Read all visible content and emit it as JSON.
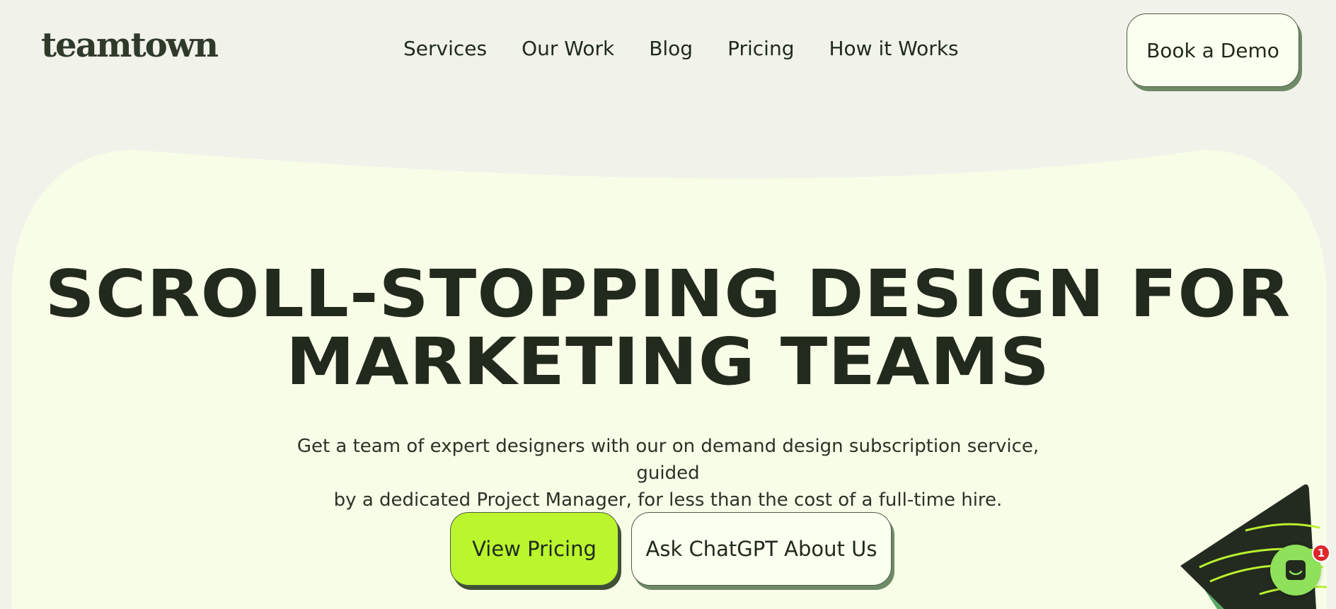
{
  "header": {
    "logo": "teamtown",
    "nav": [
      "Services",
      "Our Work",
      "Blog",
      "Pricing",
      "How it Works"
    ],
    "cta": "Book a Demo"
  },
  "hero": {
    "headline_line1": "SCROLL-STOPPING DESIGN FOR",
    "headline_line2": "MARKETING TEAMS",
    "subtitle_line1": "Get a team of expert designers with our on demand design subscription service, guided",
    "subtitle_line2": "by a dedicated Project Manager, for less than the cost of a full-time hire.",
    "primary_button": "View Pricing",
    "secondary_button": "Ask ChatGPT About Us"
  },
  "chat_widget": {
    "icon": "chat-icon",
    "badge_count": "1"
  },
  "colors": {
    "page_bg": "#f1f2ea",
    "hero_bg": "#f8fde8",
    "accent_lime": "#baf52d",
    "text_dark": "#222a1d",
    "chat_green": "#8fe05a",
    "badge_red": "#e0262b"
  }
}
